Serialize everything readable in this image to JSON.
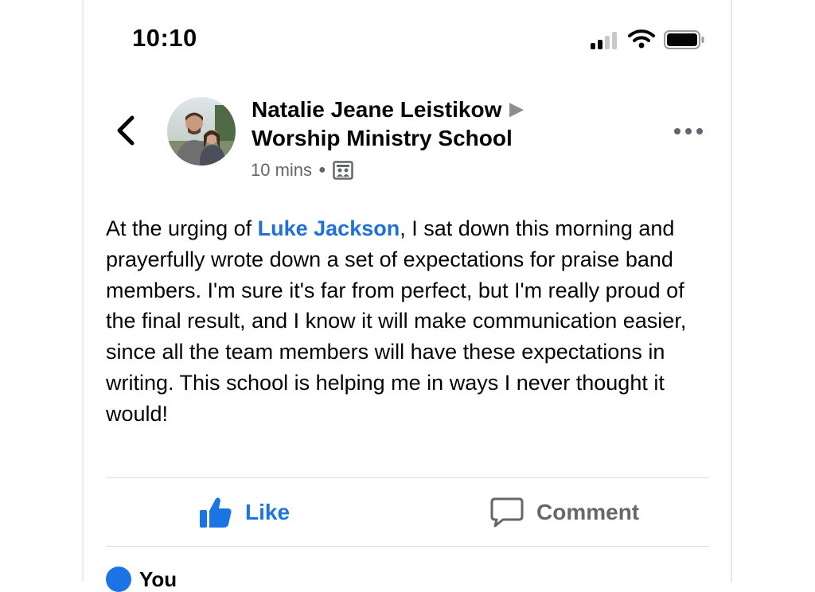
{
  "status_bar": {
    "time": "10:10"
  },
  "post": {
    "author": "Natalie Jeane Leistikow",
    "group": "Worship Ministry School",
    "time": "10 mins",
    "text_before": "At the urging of ",
    "mention": "Luke Jackson",
    "text_after": ", I sat down this morning and prayerfully wrote down a set of expectations for praise band members.  I'm sure it's far from perfect, but I'm really proud of the final result, and I know it will make communication easier, since all the team members will have these expectations in writing.  This school is helping me in ways I never thought it would!"
  },
  "actions": {
    "like_label": "Like",
    "comment_label": "Comment"
  },
  "reactions": {
    "name": "You"
  },
  "colors": {
    "like_blue": "#1b74e4",
    "mention_blue": "#216fdb",
    "secondary_gray": "#65676b"
  }
}
